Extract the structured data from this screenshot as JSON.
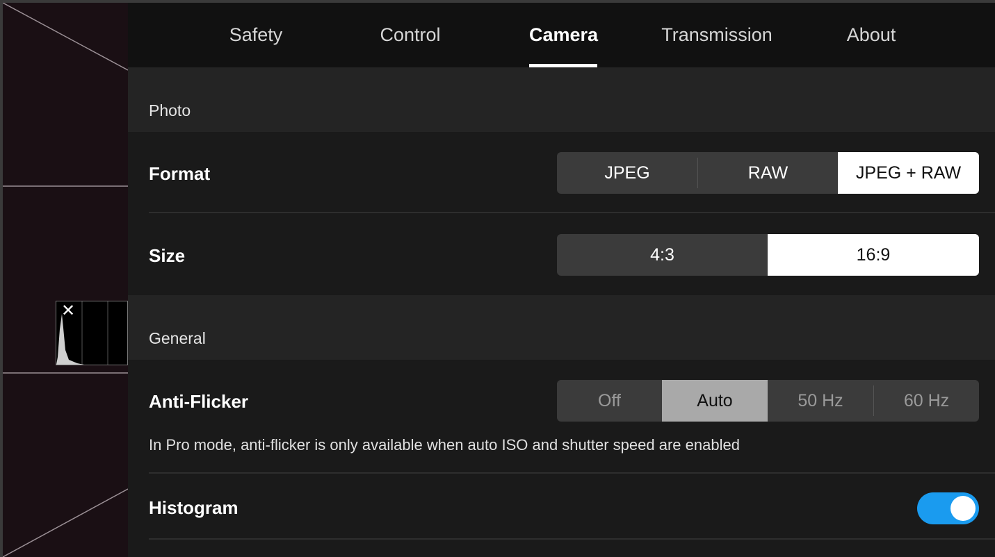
{
  "tabs": [
    {
      "label": "Safety",
      "active": false
    },
    {
      "label": "Control",
      "active": false
    },
    {
      "label": "Camera",
      "active": true
    },
    {
      "label": "Transmission",
      "active": false
    },
    {
      "label": "About",
      "active": false
    }
  ],
  "photo": {
    "section_title": "Photo",
    "format": {
      "label": "Format",
      "options": [
        "JPEG",
        "RAW",
        "JPEG + RAW"
      ],
      "selected": "JPEG + RAW"
    },
    "size": {
      "label": "Size",
      "options": [
        "4:3",
        "16:9"
      ],
      "selected": "16:9"
    }
  },
  "general": {
    "section_title": "General",
    "anti_flicker": {
      "label": "Anti-Flicker",
      "options": [
        "Off",
        "Auto",
        "50 Hz",
        "60 Hz"
      ],
      "selected": "Auto",
      "note": "In Pro mode, anti-flicker is only available when auto ISO and shutter speed are enabled"
    },
    "histogram": {
      "label": "Histogram",
      "enabled": true
    }
  },
  "camera_view": {
    "histogram_close_icon": "close-icon"
  },
  "colors": {
    "toggle_on": "#1a9bef",
    "selected_segment": "#ffffff",
    "selected_segment_dim": "#a9a9a9"
  }
}
